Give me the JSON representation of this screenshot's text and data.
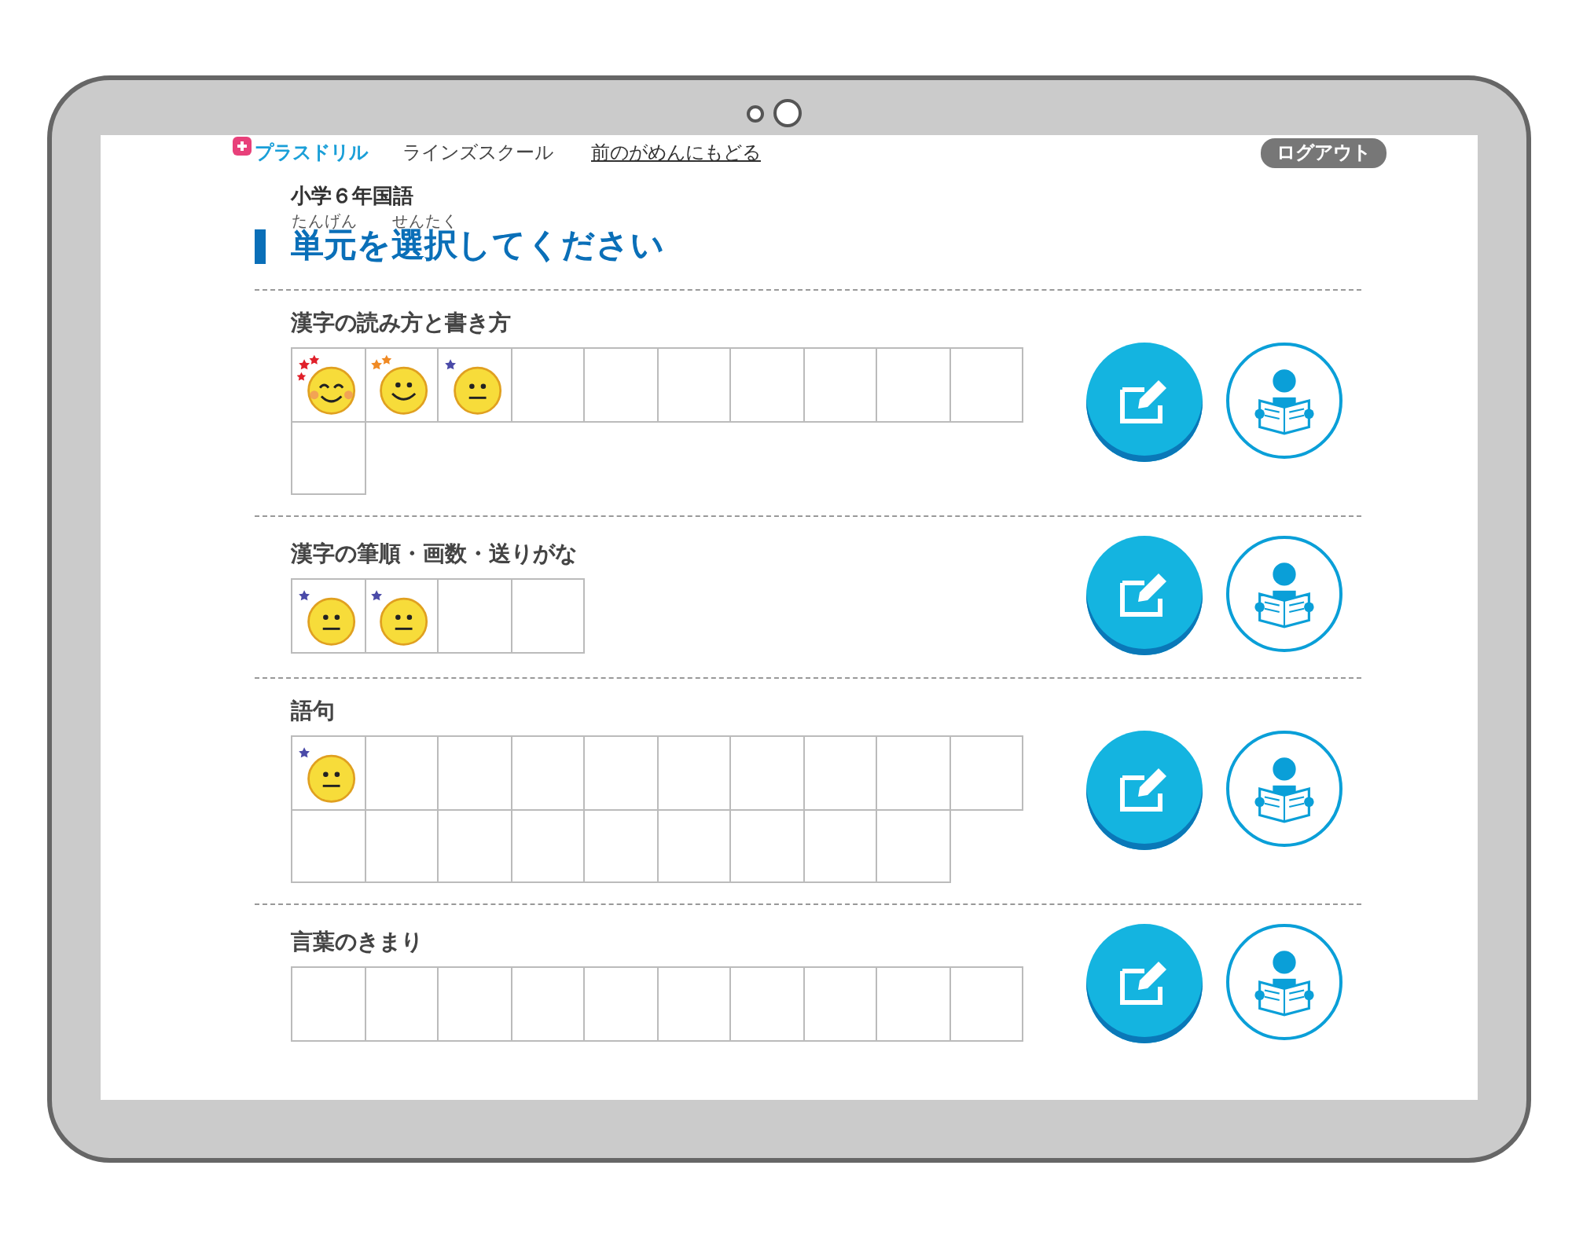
{
  "header": {
    "logo": "プラスドリル",
    "school": "ラインズスクール",
    "back_link": "前のがめんにもどる",
    "logout": "ログアウト"
  },
  "subject": "小学６年国語",
  "title": [
    {
      "base": "単元",
      "ruby": "たんげん"
    },
    {
      "base": "を"
    },
    {
      "base": "選択",
      "ruby": "せんたく"
    },
    {
      "base": "してください"
    }
  ],
  "units": [
    {
      "name": "漢字の読み方と書き方",
      "cells": [
        {
          "kind": "great"
        },
        {
          "kind": "good"
        },
        {
          "kind": "ok"
        },
        {
          "kind": "empty"
        },
        {
          "kind": "empty"
        },
        {
          "kind": "empty"
        },
        {
          "kind": "empty"
        },
        {
          "kind": "empty"
        },
        {
          "kind": "empty"
        },
        {
          "kind": "empty"
        },
        {
          "kind": "empty"
        }
      ]
    },
    {
      "name": "漢字の筆順・画数・送りがな",
      "cells": [
        {
          "kind": "ok"
        },
        {
          "kind": "ok"
        },
        {
          "kind": "empty"
        },
        {
          "kind": "empty"
        }
      ]
    },
    {
      "name": "語句",
      "cells": [
        {
          "kind": "ok"
        },
        {
          "kind": "empty"
        },
        {
          "kind": "empty"
        },
        {
          "kind": "empty"
        },
        {
          "kind": "empty"
        },
        {
          "kind": "empty"
        },
        {
          "kind": "empty"
        },
        {
          "kind": "empty"
        },
        {
          "kind": "empty"
        },
        {
          "kind": "empty"
        },
        {
          "kind": "empty"
        },
        {
          "kind": "empty"
        },
        {
          "kind": "empty"
        },
        {
          "kind": "empty"
        },
        {
          "kind": "empty"
        },
        {
          "kind": "empty"
        },
        {
          "kind": "empty"
        },
        {
          "kind": "empty"
        },
        {
          "kind": "empty"
        }
      ]
    },
    {
      "name": "言葉のきまり",
      "cells": [
        {
          "kind": "empty"
        },
        {
          "kind": "empty"
        },
        {
          "kind": "empty"
        },
        {
          "kind": "empty"
        },
        {
          "kind": "empty"
        },
        {
          "kind": "empty"
        },
        {
          "kind": "empty"
        },
        {
          "kind": "empty"
        },
        {
          "kind": "empty"
        },
        {
          "kind": "empty"
        }
      ]
    }
  ]
}
